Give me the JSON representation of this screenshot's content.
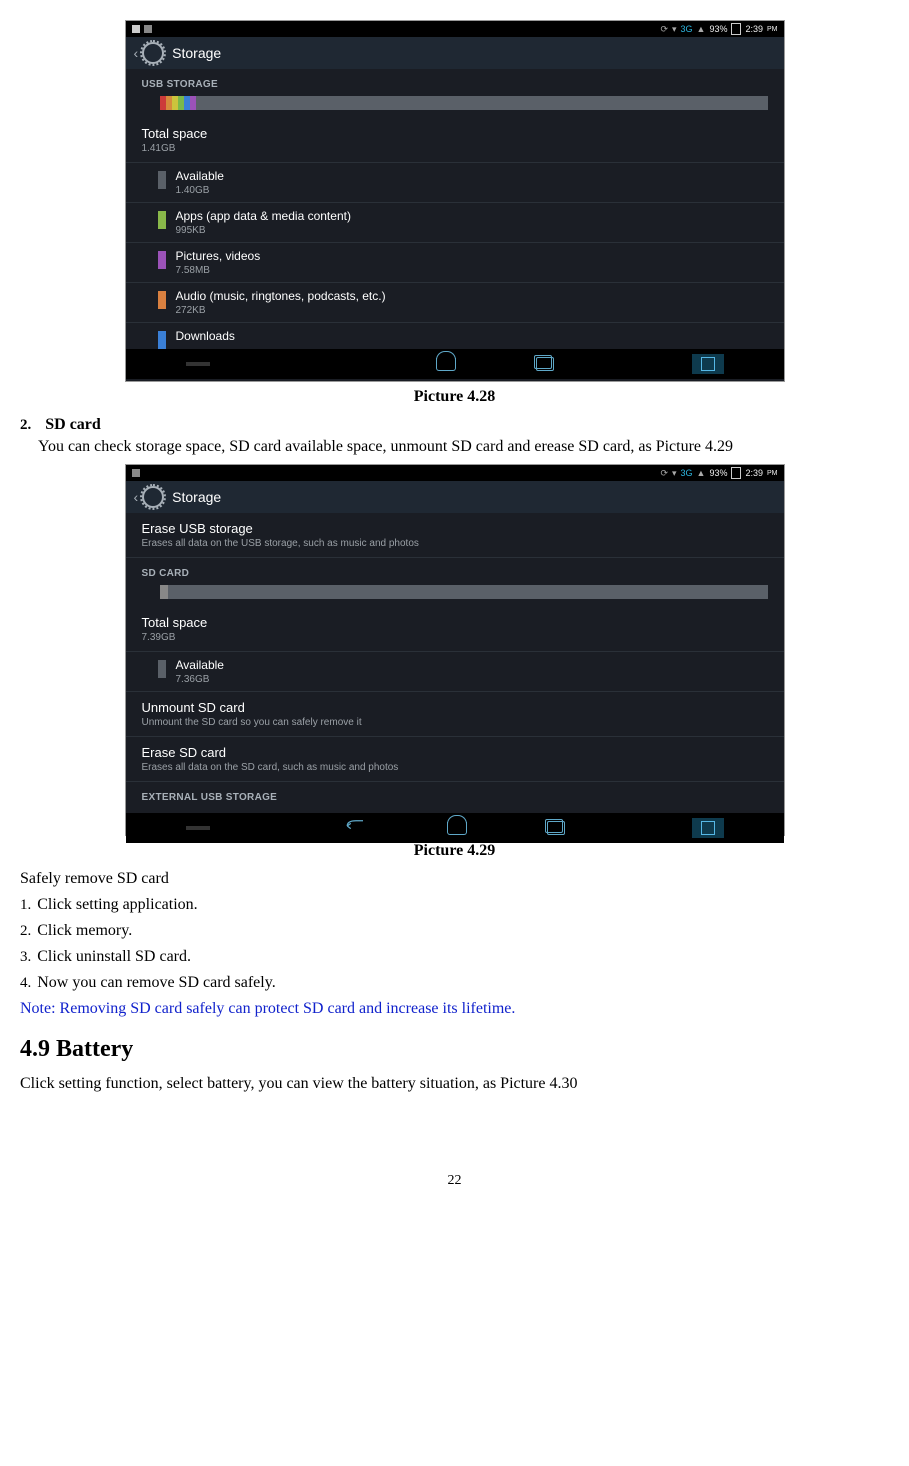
{
  "doc": {
    "caption1": "Picture 4.28",
    "section2_num": "2.",
    "section2_title": "SD card",
    "sd_para": "You can check storage space, SD card available space, unmount SD card and erease SD card, as Picture 4.29",
    "caption2": "Picture 4.29",
    "safely_title": "Safely remove SD card",
    "steps": [
      {
        "n": "1.",
        "t": "Click setting application."
      },
      {
        "n": "2.",
        "t": "Click memory."
      },
      {
        "n": "3.",
        "t": "Click uninstall SD card."
      },
      {
        "n": "4.",
        "t": "Now you can remove SD card safely."
      }
    ],
    "note": "Note: Removing SD card safely can protect SD card and increase its lifetime.",
    "heading49": "4.9 Battery",
    "battery_para": "Click setting function, select battery, you can view the battery situation, as Picture 4.30",
    "pagenum": "22"
  },
  "shot1": {
    "status": {
      "net": "3G",
      "batt": "93%",
      "time": "2:39"
    },
    "header": "Storage",
    "section": "USB STORAGE",
    "total_label": "Total space",
    "total_val": "1.41GB",
    "items": [
      {
        "label": "Available",
        "sub": "1.40GB",
        "color": "#5a6068"
      },
      {
        "label": "Apps (app data & media content)",
        "sub": "995KB",
        "color": "#89b84a"
      },
      {
        "label": "Pictures, videos",
        "sub": "7.58MB",
        "color": "#9b52b8"
      },
      {
        "label": "Audio (music, ringtones, podcasts, etc.)",
        "sub": "272KB",
        "color": "#d98040"
      },
      {
        "label": "Downloads",
        "sub": "",
        "color": "#3a7fd6"
      }
    ],
    "bar_colors": [
      "#cc3a3a",
      "#d68a3c",
      "#ccc43c",
      "#7ab84a",
      "#3a7fd6",
      "#9b52b8"
    ]
  },
  "shot2": {
    "status": {
      "net": "3G",
      "batt": "93%",
      "time": "2:39"
    },
    "header": "Storage",
    "erase_usb_label": "Erase USB storage",
    "erase_usb_sub": "Erases all data on the USB storage, such as music and photos",
    "sd_section": "SD CARD",
    "total_label": "Total space",
    "total_val": "7.39GB",
    "avail_label": "Available",
    "avail_val": "7.36GB",
    "unmount_label": "Unmount SD card",
    "unmount_sub": "Unmount the SD card so you can safely remove it",
    "erase_sd_label": "Erase SD card",
    "erase_sd_sub": "Erases all data on the SD card, such as music and photos",
    "ext_section": "EXTERNAL USB STORAGE"
  }
}
